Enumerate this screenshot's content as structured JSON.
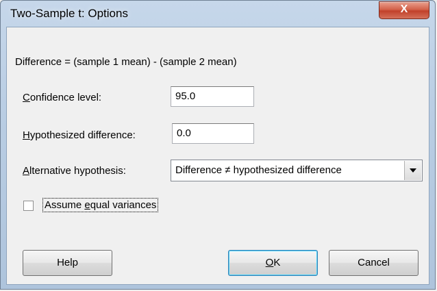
{
  "window": {
    "title": "Two-Sample t: Options",
    "close_label": "X"
  },
  "difference_text": "Difference = (sample 1 mean) - (sample 2 mean)",
  "confidence": {
    "accel": "C",
    "rest": "onfidence level:",
    "value": "95.0"
  },
  "hypothesized": {
    "accel": "H",
    "rest": "ypothesized difference:",
    "value": "0.0"
  },
  "alternative": {
    "accel": "A",
    "rest": "lternative hypothesis:",
    "value": "Difference ≠ hypothesized difference"
  },
  "equal_variances": {
    "pre": "Assume ",
    "accel": "e",
    "rest": "qual variances",
    "checked": false
  },
  "buttons": {
    "help": "Help",
    "ok_accel": "O",
    "ok_rest": "K",
    "cancel": "Cancel"
  },
  "colors": {
    "close": "#c1412b",
    "default_button_border": "#3c7fb1"
  }
}
